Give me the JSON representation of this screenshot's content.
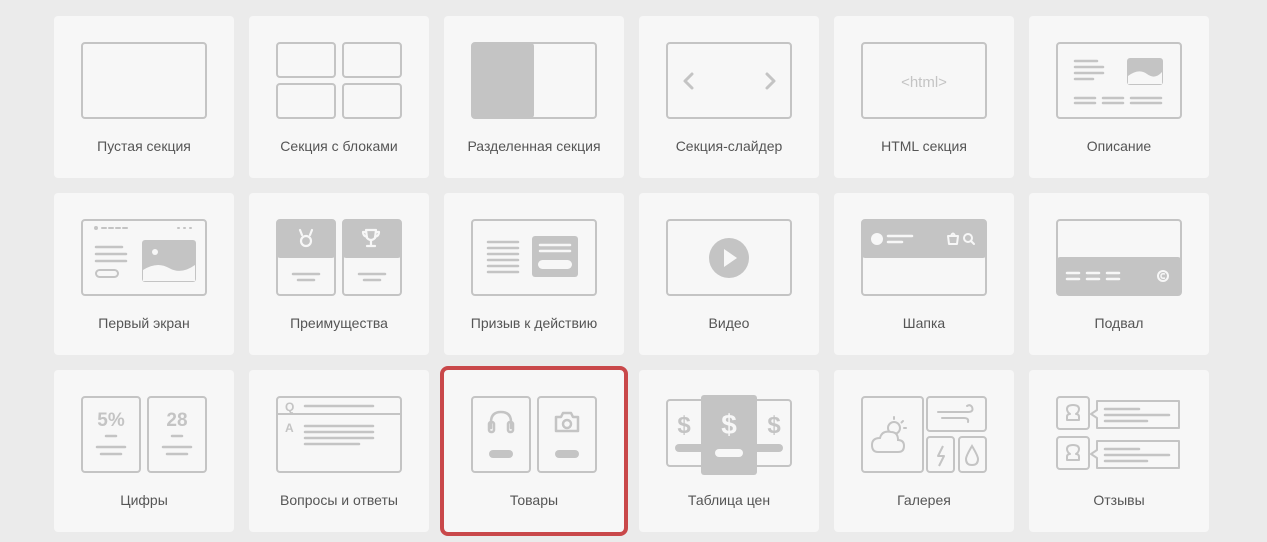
{
  "colors": {
    "icon_stroke": "#c4c4c4",
    "icon_fill": "#c4c4c4",
    "tile_bg": "#f7f7f7",
    "page_bg": "#ebebeb",
    "selected_border": "#c9484a",
    "label": "#555555"
  },
  "tiles": [
    {
      "label": "Пустая секция",
      "icon": "empty-section-icon"
    },
    {
      "label": "Секция с блоками",
      "icon": "blocks-section-icon"
    },
    {
      "label": "Разделенная секция",
      "icon": "split-section-icon"
    },
    {
      "label": "Секция-слайдер",
      "icon": "slider-section-icon"
    },
    {
      "label": "HTML секция",
      "icon": "html-section-icon",
      "icon_text": "<html>"
    },
    {
      "label": "Описание",
      "icon": "description-icon"
    },
    {
      "label": "Первый экран",
      "icon": "first-screen-icon"
    },
    {
      "label": "Преимущества",
      "icon": "advantages-icon"
    },
    {
      "label": "Призыв к действию",
      "icon": "call-to-action-icon"
    },
    {
      "label": "Видео",
      "icon": "video-icon"
    },
    {
      "label": "Шапка",
      "icon": "header-icon"
    },
    {
      "label": "Подвал",
      "icon": "footer-icon"
    },
    {
      "label": "Цифры",
      "icon": "numbers-icon",
      "icon_text_left": "5%",
      "icon_text_right": "28"
    },
    {
      "label": "Вопросы и ответы",
      "icon": "faq-icon",
      "icon_text_q": "Q",
      "icon_text_a": "A"
    },
    {
      "label": "Товары",
      "icon": "products-icon",
      "selected": true
    },
    {
      "label": "Таблица цен",
      "icon": "pricing-table-icon",
      "icon_text": "$"
    },
    {
      "label": "Галерея",
      "icon": "gallery-icon"
    },
    {
      "label": "Отзывы",
      "icon": "reviews-icon"
    }
  ]
}
